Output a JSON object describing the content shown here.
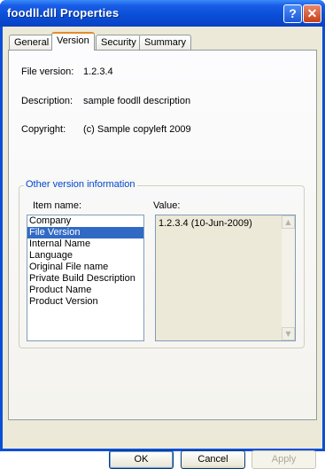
{
  "window": {
    "title": "foodll.dll Properties",
    "help_glyph": "?",
    "close_glyph": "✕"
  },
  "tabs": [
    {
      "label": "General"
    },
    {
      "label": "Version"
    },
    {
      "label": "Security"
    },
    {
      "label": "Summary"
    }
  ],
  "version_tab": {
    "file_version_label": "File version:",
    "file_version_value": "1.2.3.4",
    "description_label": "Description:",
    "description_value": "sample foodll description",
    "copyright_label": "Copyright:",
    "copyright_value": "(c) Sample copyleft 2009",
    "group_title": "Other version information",
    "item_name_label": "Item name:",
    "value_label": "Value:",
    "items": [
      "Company",
      "File Version",
      "Internal Name",
      "Language",
      "Original File name",
      "Private Build Description",
      "Product Name",
      "Product Version"
    ],
    "selected_item": "File Version",
    "selected_value": "1.2.3.4 (10-Jun-2009)"
  },
  "buttons": {
    "ok": "OK",
    "cancel": "Cancel",
    "apply": "Apply"
  },
  "colors": {
    "title_bar": "#0a4fd8",
    "selection": "#316ac5",
    "group_title": "#0046d5",
    "dialog_bg": "#ece9d8"
  },
  "icons": {
    "help": "help-icon",
    "close": "close-icon",
    "scroll_up": "scroll-up-arrow-icon",
    "scroll_down": "scroll-down-arrow-icon"
  }
}
